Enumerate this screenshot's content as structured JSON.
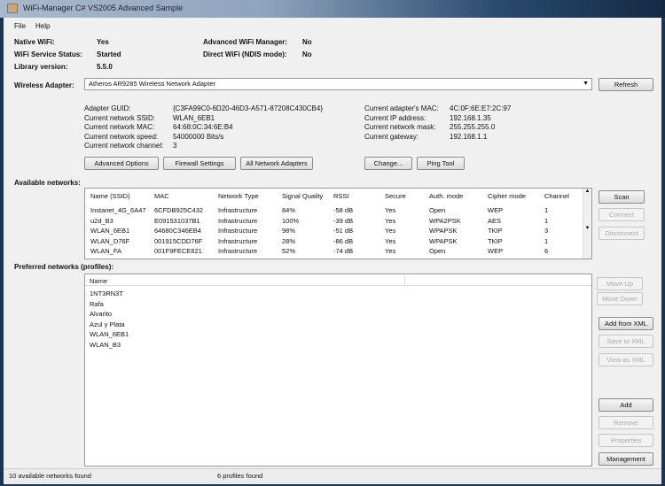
{
  "window": {
    "title": "WiFi-Manager C# VS2005 Advanced Sample"
  },
  "menu": [
    "File",
    "Help"
  ],
  "info": {
    "native_wifi_label": "Native WiFi:",
    "native_wifi": "Yes",
    "service_label": "WiFi Service Status:",
    "service": "Started",
    "lib_label": "Library version:",
    "lib": "5.5.0",
    "adv_label": "Advanced WiFi Manager:",
    "adv": "No",
    "direct_label": "Direct WiFi (NDIS mode):",
    "direct": "No"
  },
  "adapter": {
    "label": "Wireless Adapter:",
    "value": "Atheros AR9285 Wireless Network Adapter",
    "refresh": "Refresh"
  },
  "details": {
    "left": [
      [
        "Adapter GUID:",
        "{C3FA99C0-6D20-46D3-A571-87208C430CB4}"
      ],
      [
        "Current network SSID:",
        "WLAN_6EB1"
      ],
      [
        "Current network MAC:",
        "64:68:0C:34:6E:B4"
      ],
      [
        "Current network speed:",
        "54000000 Bits/s"
      ],
      [
        "Current network channel:",
        "3"
      ]
    ],
    "right": [
      [
        "Current adapter's MAC:",
        "4C:0F:6E:E7:2C:97"
      ],
      [
        "Current IP address:",
        "192.168.1.35"
      ],
      [
        "Current network mask:",
        "255.255.255.0"
      ],
      [
        "Current gateway:",
        "192.168.1.1"
      ]
    ],
    "buttons": [
      "Advanced Options",
      "Firewall Settings",
      "All Network Adapters",
      "Change...",
      "Ping Tool"
    ]
  },
  "networks": {
    "label": "Available networks:",
    "columns": [
      "Name (SSID)",
      "MAC",
      "Network Type",
      "Signal Quality",
      "RSSI",
      "Secure",
      "Auth. mode",
      "Cipher mode",
      "Channel"
    ],
    "rows": [
      [
        "Instanet_4G_6A47",
        "6CFDB925C432",
        "Infrastructure",
        "84%",
        "-58 dB",
        "Yes",
        "Open",
        "WEP",
        "1"
      ],
      [
        "u2d_B3",
        "E091531037B1",
        "Infrastructure",
        "100%",
        "-39 dB",
        "Yes",
        "WPA2PSK",
        "AES",
        "1"
      ],
      [
        "WLAN_6EB1",
        "64680C346EB4",
        "Infrastructure",
        "98%",
        "-51 dB",
        "Yes",
        "WPAPSK",
        "TKIP",
        "3"
      ],
      [
        "WLAN_D76F",
        "001915CDD76F",
        "Infrastructure",
        "28%",
        "-86 dB",
        "Yes",
        "WPAPSK",
        "TKIP",
        "1"
      ],
      [
        "WLAN_FA",
        "001F9FECE821",
        "Infrastructure",
        "52%",
        "-74 dB",
        "Yes",
        "Open",
        "WEP",
        "6"
      ]
    ],
    "buttons": [
      "Scan",
      "Connect",
      "Disconnect"
    ]
  },
  "profiles": {
    "label": "Preferred networks (profiles):",
    "column": "Name",
    "items": [
      "1NT3RN3T",
      "Rafa",
      "Alvarito",
      "Azul y Plata",
      "WLAN_6EB1",
      "WLAN_B3"
    ],
    "buttons": [
      "Move Up",
      "Move Down",
      "Add from XML",
      "Save to XML",
      "View as XML",
      "Add",
      "Remove",
      "Properties",
      "Management"
    ]
  },
  "status": {
    "networks": "10 available networks found",
    "profiles": "6 profiles found"
  }
}
